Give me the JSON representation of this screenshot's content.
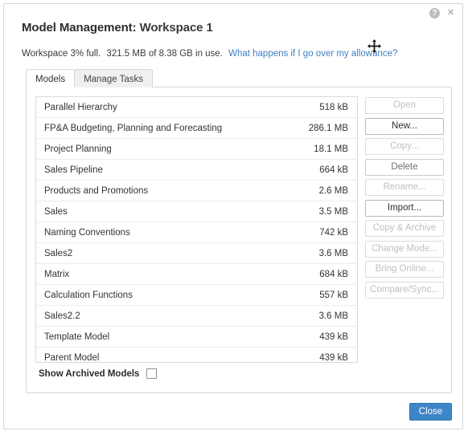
{
  "window": {
    "help_icon_glyph": "?",
    "close_icon_glyph": "×",
    "move_cursor_icon": "move-cursor"
  },
  "header": {
    "title_prefix": "Model Management:",
    "workspace_name": "Workspace 1",
    "usage_text_1": "Workspace 3% full.",
    "usage_text_2": "321.5 MB of 8.38 GB in use.",
    "usage_link": "What happens if I go over my allowance?",
    "link_color": "#3f7fc1"
  },
  "tabs": [
    {
      "label": "Models",
      "active": true
    },
    {
      "label": "Manage Tasks",
      "active": false
    }
  ],
  "models": [
    {
      "name": "Parallel Hierarchy",
      "size": "518 kB"
    },
    {
      "name": "FP&A Budgeting, Planning and Forecasting",
      "size": "286.1 MB"
    },
    {
      "name": "Project Planning",
      "size": "18.1 MB"
    },
    {
      "name": "Sales Pipeline",
      "size": "664 kB"
    },
    {
      "name": "Products and Promotions",
      "size": "2.6 MB"
    },
    {
      "name": "Sales",
      "size": "3.5 MB"
    },
    {
      "name": "Naming Conventions",
      "size": "742 kB"
    },
    {
      "name": "Sales2",
      "size": "3.6 MB"
    },
    {
      "name": "Matrix",
      "size": "684 kB"
    },
    {
      "name": "Calculation Functions",
      "size": "557 kB"
    },
    {
      "name": "Sales2.2",
      "size": "3.6 MB"
    },
    {
      "name": "Template Model",
      "size": "439 kB"
    },
    {
      "name": "Parent Model",
      "size": "439 kB"
    }
  ],
  "side_buttons": [
    {
      "label": "Open",
      "state": "disabled"
    },
    {
      "label": "New...",
      "state": "enabled"
    },
    {
      "label": "Copy...",
      "state": "disabled"
    },
    {
      "label": "Delete",
      "state": "semi"
    },
    {
      "label": "Rename...",
      "state": "disabled"
    },
    {
      "label": "Import...",
      "state": "enabled"
    },
    {
      "label": "Copy & Archive",
      "state": "disabled"
    },
    {
      "label": "Change Mode...",
      "state": "disabled"
    },
    {
      "label": "Bring Online...",
      "state": "disabled"
    },
    {
      "label": "Compare/Sync...",
      "state": "disabled"
    }
  ],
  "archived": {
    "label": "Show Archived Models",
    "checked": false
  },
  "footer": {
    "close_label": "Close",
    "close_color": "#3e86c8"
  }
}
